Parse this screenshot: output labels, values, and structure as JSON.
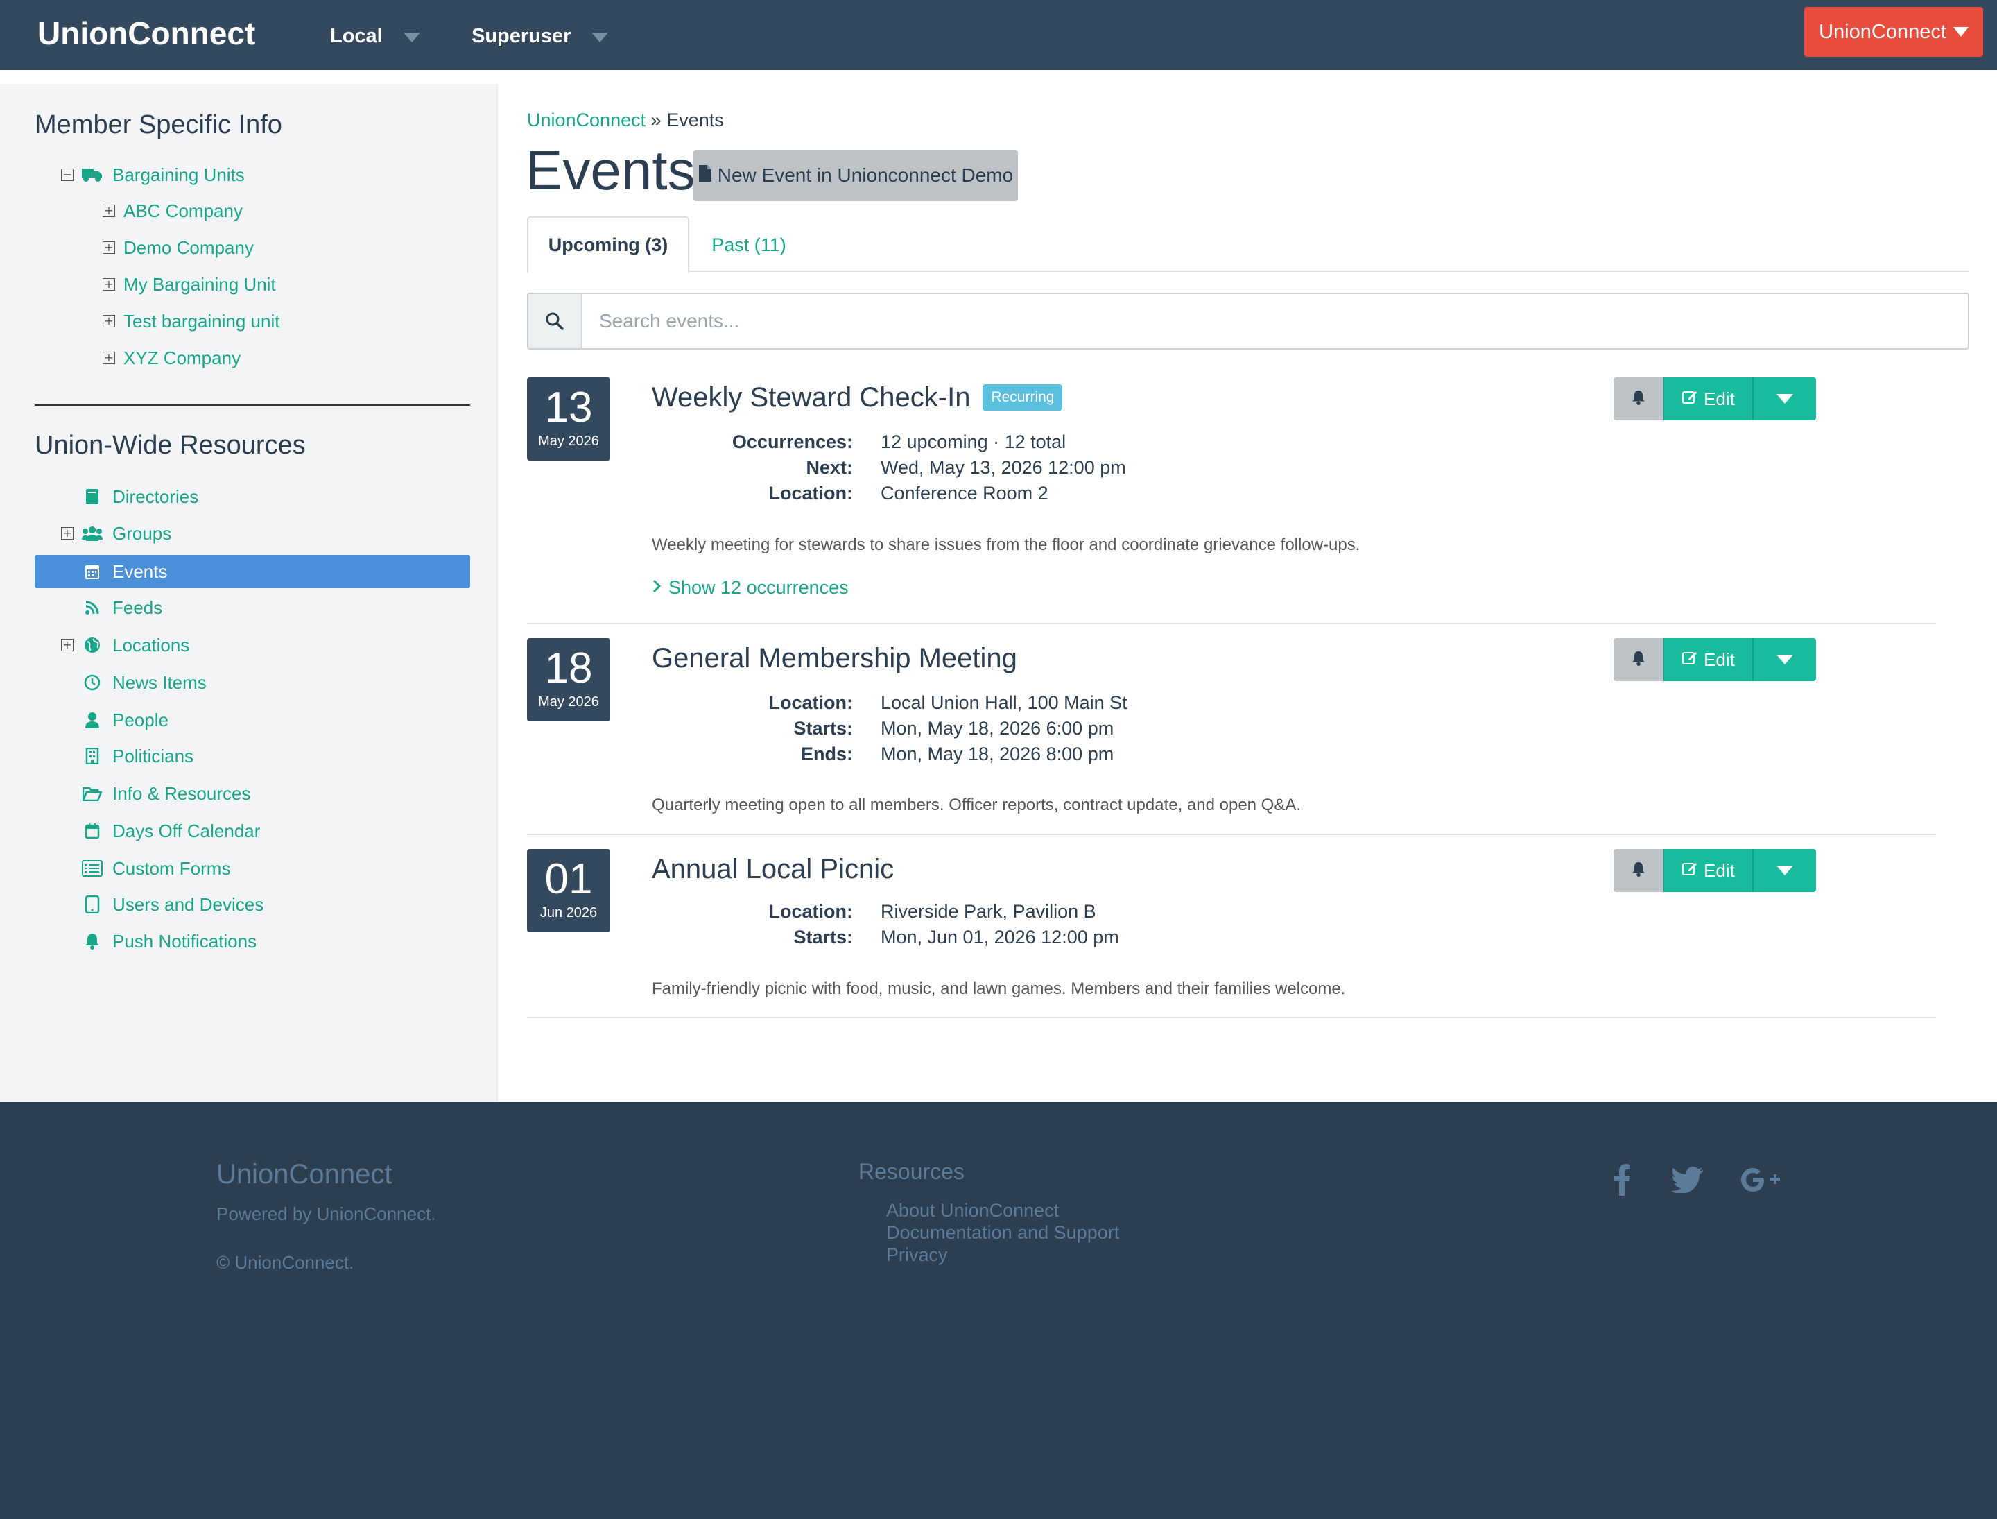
{
  "navbar": {
    "brand": "UnionConnect",
    "menu_local": "Local",
    "menu_superuser": "Superuser",
    "account_button": "UnionConnect"
  },
  "sidebar": {
    "member_heading": "Member Specific Info",
    "bargaining_units": {
      "label": "Bargaining Units",
      "icon": "truck-icon",
      "children": [
        "ABC Company",
        "Demo Company",
        "My Bargaining Unit",
        "Test bargaining unit",
        "XYZ Company"
      ]
    },
    "union_heading": "Union-Wide Resources",
    "items": [
      {
        "label": "Directories",
        "icon": "book-icon"
      },
      {
        "label": "Groups",
        "icon": "users-icon"
      },
      {
        "label": "Events",
        "icon": "calendar-icon",
        "active": true
      },
      {
        "label": "Feeds",
        "icon": "rss-icon"
      },
      {
        "label": "Locations",
        "icon": "globe-icon"
      },
      {
        "label": "News Items",
        "icon": "clock-icon"
      },
      {
        "label": "People",
        "icon": "user-icon"
      },
      {
        "label": "Politicians",
        "icon": "building-icon"
      },
      {
        "label": "Info & Resources",
        "icon": "folder-open-icon"
      },
      {
        "label": "Days Off Calendar",
        "icon": "calendar-empty-icon"
      },
      {
        "label": "Custom Forms",
        "icon": "list-alt-icon"
      },
      {
        "label": "Users and Devices",
        "icon": "tablet-icon"
      },
      {
        "label": "Push Notifications",
        "icon": "bell-icon"
      }
    ]
  },
  "breadcrumb": {
    "home": "UnionConnect",
    "separator": "»",
    "current": "Events"
  },
  "page_title": "Events",
  "new_event_button": "New Event in Unionconnect Demo",
  "tabs": {
    "upcoming": "Upcoming (3)",
    "past": "Past (11)"
  },
  "search": {
    "placeholder": "Search events..."
  },
  "event_actions": {
    "edit": "Edit"
  },
  "events": [
    {
      "day": "13",
      "month": "May 2026",
      "title": "Weekly Steward Check-In",
      "badge": "Recurring",
      "details": [
        {
          "k": "Occurrences:",
          "v": "12 upcoming · 12 total"
        },
        {
          "k": "Next:",
          "v": "Wed, May 13, 2026 12:00 pm"
        },
        {
          "k": "Location:",
          "v": "Conference Room 2"
        }
      ],
      "description": "Weekly meeting for stewards to share issues from the floor and coordinate grievance follow-ups.",
      "show_link": "Show 12 occurrences"
    },
    {
      "day": "18",
      "month": "May 2026",
      "title": "General Membership Meeting",
      "details": [
        {
          "k": "Location:",
          "v": "Local Union Hall, 100 Main St"
        },
        {
          "k": "Starts:",
          "v": "Mon, May 18, 2026 6:00 pm"
        },
        {
          "k": "Ends:",
          "v": "Mon, May 18, 2026 8:00 pm"
        }
      ],
      "description": "Quarterly meeting open to all members. Officer reports, contract update, and open Q&A."
    },
    {
      "day": "01",
      "month": "Jun 2026",
      "title": "Annual Local Picnic",
      "details": [
        {
          "k": "Location:",
          "v": "Riverside Park, Pavilion B"
        },
        {
          "k": "Starts:",
          "v": "Mon, Jun 01, 2026 12:00 pm"
        }
      ],
      "description": "Family-friendly picnic with food, music, and lawn games. Members and their families welcome."
    }
  ],
  "footer": {
    "brand": "UnionConnect",
    "powered": "Powered by UnionConnect.",
    "copyright": "© UnionConnect.",
    "resources_heading": "Resources",
    "links": [
      "About UnionConnect",
      "Documentation and Support",
      "Privacy"
    ],
    "social": [
      "facebook-icon",
      "twitter-icon",
      "google-plus-icon"
    ]
  },
  "colors": {
    "navbar": "#34495e",
    "accent": "#18a689",
    "account_button": "#e74c3c",
    "active_item": "#4a90d9",
    "edit_button": "#18bc9c",
    "badge": "#5bc0de",
    "footer": "#2d3e50"
  }
}
